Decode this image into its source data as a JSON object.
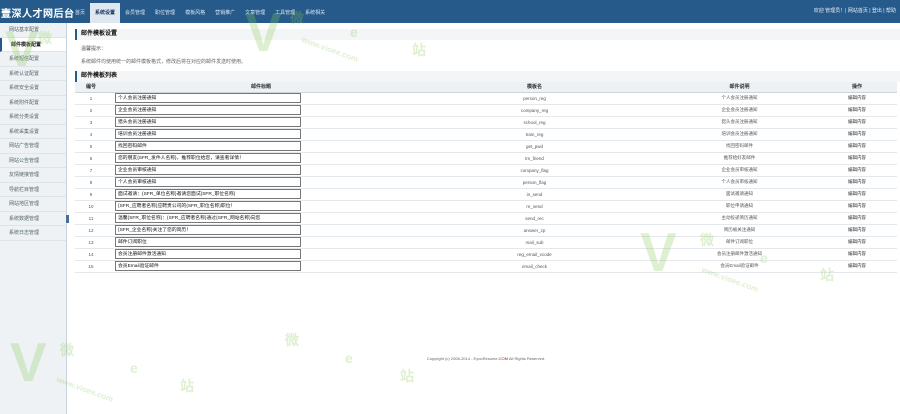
{
  "header": {
    "logo": "壹深人才网后台",
    "nav": [
      {
        "label": "首页",
        "active": false
      },
      {
        "label": "系统设置",
        "active": true
      },
      {
        "label": "会员管理",
        "active": false
      },
      {
        "label": "职位管理",
        "active": false
      },
      {
        "label": "模板风格",
        "active": false
      },
      {
        "label": "营销推广",
        "active": false
      },
      {
        "label": "文章管理",
        "active": false
      },
      {
        "label": "工具管理",
        "active": false
      },
      {
        "label": "系统相关",
        "active": false
      }
    ],
    "right": "欢迎 管理员！| 网站首页 | 登出 | 帮助"
  },
  "sidebar": {
    "items": [
      {
        "label": "网站基本配置",
        "active": false
      },
      {
        "label": "邮件模板配置",
        "active": true
      },
      {
        "label": "系统短信配置",
        "active": false
      },
      {
        "label": "系统认证配置",
        "active": false
      },
      {
        "label": "系统安全设置",
        "active": false
      },
      {
        "label": "系统附件配置",
        "active": false
      },
      {
        "label": "系统分类设置",
        "active": false
      },
      {
        "label": "系统采集设置",
        "active": false
      },
      {
        "label": "网站广告管理",
        "active": false
      },
      {
        "label": "网站公告管理",
        "active": false
      },
      {
        "label": "友情链接管理",
        "active": false
      },
      {
        "label": "导航栏目管理",
        "active": false
      },
      {
        "label": "网站地区管理",
        "active": false
      },
      {
        "label": "系统数据管理",
        "active": false
      },
      {
        "label": "系统日志管理",
        "active": false
      }
    ]
  },
  "main": {
    "section1_title": "邮件模板设置",
    "tip_label": "温馨提示：",
    "tip_text": "系统邮件均使用统一的邮件模板格式，修改后将在对应的邮件发送时使用。",
    "section2_title": "邮件模板列表",
    "columns": {
      "no": "编号",
      "title": "邮件标题",
      "tpl": "模板名",
      "desc": "邮件说明",
      "op": "操作"
    },
    "edit_label": "编辑内容",
    "rows": [
      {
        "no": "1",
        "title": "个人会员注册通知",
        "tpl": "person_reg",
        "desc": "个人会员注册通知"
      },
      {
        "no": "2",
        "title": "企业会员注册通知",
        "tpl": "company_reg",
        "desc": "企业会员注册通知"
      },
      {
        "no": "3",
        "title": "猎头会员注册通知",
        "tpl": "school_reg",
        "desc": "猎头会员注册通知"
      },
      {
        "no": "4",
        "title": "培训会员注册通知",
        "tpl": "train_reg",
        "desc": "培训会员注册通知"
      },
      {
        "no": "5",
        "title": "找回密码邮件",
        "tpl": "get_pwd",
        "desc": "找回密码邮件"
      },
      {
        "no": "6",
        "title": "您的朋友{SFR_发件人名称}，推荐职位给您，请查看详情！",
        "tpl": "tm_friend",
        "desc": "推荐给好友邮件"
      },
      {
        "no": "7",
        "title": "企业会员审核通知",
        "tpl": "company_flag",
        "desc": "企业会员审核通知"
      },
      {
        "no": "8",
        "title": "个人会员审核通知",
        "tpl": "person_flag",
        "desc": "个人会员审核通知"
      },
      {
        "no": "9",
        "title": "面试邀请：{SFR_单位名称}邀请您面试{SFR_职位名称}",
        "tpl": "in_send",
        "desc": "面试邀请通知"
      },
      {
        "no": "10",
        "title": "{SFR_应聘者名称}应聘贵公司的{SFR_职位名称}职位！",
        "tpl": "re_send",
        "desc": "职位申请通知"
      },
      {
        "no": "11",
        "title": "温馨{SFR_职位名称}：{SFR_应聘者名称}通过{SFR_网站名称}向您",
        "tpl": "send_rec",
        "desc": "主动投递简历通知"
      },
      {
        "no": "12",
        "title": "{SFR_企业名称}关注了您的简历！",
        "tpl": "answer_zp",
        "desc": "简历被关注通知"
      },
      {
        "no": "13",
        "title": "邮件订阅职位",
        "tpl": "mail_sub",
        "desc": "邮件订阅职位"
      },
      {
        "no": "14",
        "title": "会员注册邮件激活通知",
        "tpl": "reg_email_vcode",
        "desc": "会员注册邮件激活通知"
      },
      {
        "no": "15",
        "title": "会员Email验证邮件",
        "tpl": "email_check",
        "desc": "会员Email验证邮件"
      }
    ],
    "footer_prefix": "Copyright (c) 2008-2014 - EyooResume.",
    "footer_brand": "COM",
    "footer_suffix": " All Rights Reserved."
  },
  "watermark": {
    "big": "V",
    "char1": "微",
    "char2": "e",
    "char3": "站",
    "url": "www.vioee.com",
    "color": "#8cc85a"
  }
}
